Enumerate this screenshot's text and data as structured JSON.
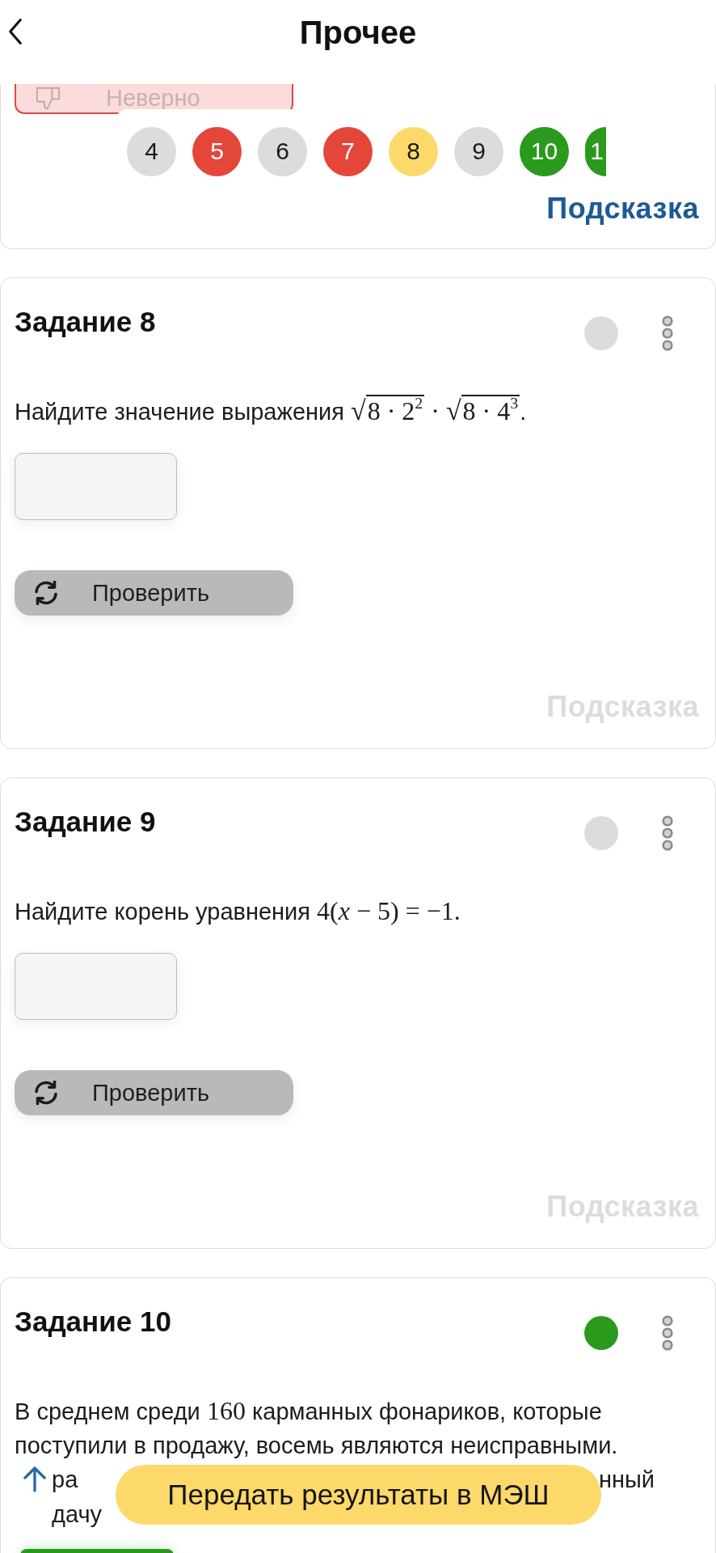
{
  "header": {
    "title": "Прочее"
  },
  "task_nav": [
    {
      "label": "4",
      "color": "#dcdcdc",
      "kind": "full"
    },
    {
      "label": "5",
      "color": "#e4463a",
      "kind": "full"
    },
    {
      "label": "6",
      "color": "#dcdcdc",
      "kind": "full"
    },
    {
      "label": "7",
      "color": "#e4463a",
      "kind": "full"
    },
    {
      "label": "8",
      "color": "#fdd96b",
      "kind": "full"
    },
    {
      "label": "9",
      "color": "#dcdcdc",
      "kind": "full"
    },
    {
      "label": "10",
      "color": "#2a9a1d",
      "kind": "full"
    },
    {
      "label": "1",
      "color": "#2a9a1d",
      "kind": "cut"
    }
  ],
  "tasks": [
    {
      "kind": "cut_top",
      "result": {
        "kind": "wrong",
        "label": "Неверно"
      },
      "hint": {
        "label": "Подсказка",
        "disabled": false
      }
    },
    {
      "kind": "full",
      "title": "Задание 8",
      "color": "#dcdcdc",
      "question": [
        {
          "kind": "text",
          "text": "Найдите значение выражения "
        },
        {
          "kind": "sqrt",
          "radical": "√",
          "text": "8 · 2$^{2}$"
        },
        {
          "kind": "math",
          "text": " · "
        },
        {
          "kind": "sqrt",
          "radical": "√",
          "text": "8 · 4$^{3}$"
        },
        {
          "kind": "text",
          "text": "."
        }
      ],
      "check_button": "Проверить",
      "hint": {
        "label": "Подсказка",
        "disabled": true
      }
    },
    {
      "kind": "full",
      "title": "Задание 9",
      "color": "#dcdcdc",
      "question": [
        {
          "kind": "text",
          "text": "Найдите корень уравнения "
        },
        {
          "kind": "math",
          "text": "4(*x* − 5) = −1."
        }
      ],
      "check_button": "Проверить",
      "hint": {
        "label": "Подсказка",
        "disabled": true
      }
    },
    {
      "kind": "cut_bottom",
      "title": "Задание 10",
      "color": "#2a9a1d",
      "question_lines": [
        {
          "kind": "full",
          "segments": [
            {
              "kind": "text",
              "text": "В среднем среди "
            },
            {
              "kind": "math",
              "text": "160"
            },
            {
              "kind": "text",
              "text": " карманных фонариков, которые"
            }
          ]
        },
        {
          "kind": "full",
          "segments": [
            {
              "kind": "text",
              "text": "поступили в продажу, восемь являются неисправными."
            }
          ]
        },
        {
          "kind": "after_icon",
          "segments": [
            {
              "kind": "text",
              "text": "ра"
            }
          ],
          "tail": [
            {
              "kind": "text",
              "text": "нный"
            }
          ]
        },
        {
          "kind": "after_icon",
          "segments": [
            {
              "kind": "text",
              "text": "дачу"
            }
          ]
        }
      ],
      "result": {
        "kind": "correct"
      }
    }
  ],
  "submit_button": "Передать результаты в МЭШ"
}
